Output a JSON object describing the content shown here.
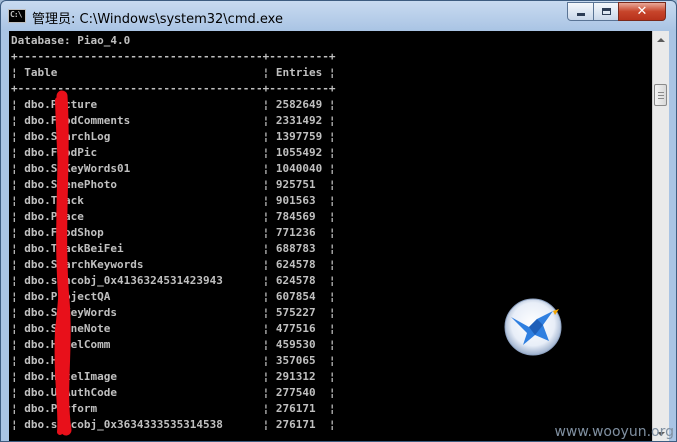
{
  "window": {
    "title": "管理员: C:\\Windows\\system32\\cmd.exe",
    "app_icon_text": "C:\\"
  },
  "console": {
    "database_line": "Database: Piao_4.0",
    "border_line": "+-------------------------------------+---------+",
    "header_table": "Table",
    "header_entries": "Entries",
    "rows": [
      {
        "table": "dbo.Picture",
        "entries": "2582649"
      },
      {
        "table": "dbo.FoodComments",
        "entries": "2331492"
      },
      {
        "table": "dbo.SearchLog",
        "entries": "1397759"
      },
      {
        "table": "dbo.FoodPic",
        "entries": "1055492"
      },
      {
        "table": "dbo.SeKeyWords01",
        "entries": "1040040"
      },
      {
        "table": "dbo.ScenePhoto",
        "entries": "925751"
      },
      {
        "table": "dbo.Track",
        "entries": "901563"
      },
      {
        "table": "dbo.Place",
        "entries": "784569"
      },
      {
        "table": "dbo.FoodShop",
        "entries": "771236"
      },
      {
        "table": "dbo.TrackBeiFei",
        "entries": "688783"
      },
      {
        "table": "dbo.SearchKeywords",
        "entries": "624578"
      },
      {
        "table": "dbo.syncobj_0x4136324531423943",
        "entries": "624578"
      },
      {
        "table": "dbo.ProjectQA",
        "entries": "607854"
      },
      {
        "table": "dbo.SeKeyWords",
        "entries": "575227"
      },
      {
        "table": "dbo.SceneNote",
        "entries": "477516"
      },
      {
        "table": "dbo.HotelComm",
        "entries": "459530"
      },
      {
        "table": "dbo.H",
        "entries": "357065"
      },
      {
        "table": "dbo.HotelImage",
        "entries": "291312"
      },
      {
        "table": "dbo.U_AuthCode",
        "entries": "277540"
      },
      {
        "table": "dbo.Perform",
        "entries": "276171"
      },
      {
        "table": "dbo.syncobj_0x3634333535314538",
        "entries": "276171"
      }
    ]
  },
  "watermark": "www.wooyun.org",
  "colors": {
    "console_bg": "#000000",
    "console_fg": "#c0c0c0",
    "redaction": "#e8101a"
  }
}
